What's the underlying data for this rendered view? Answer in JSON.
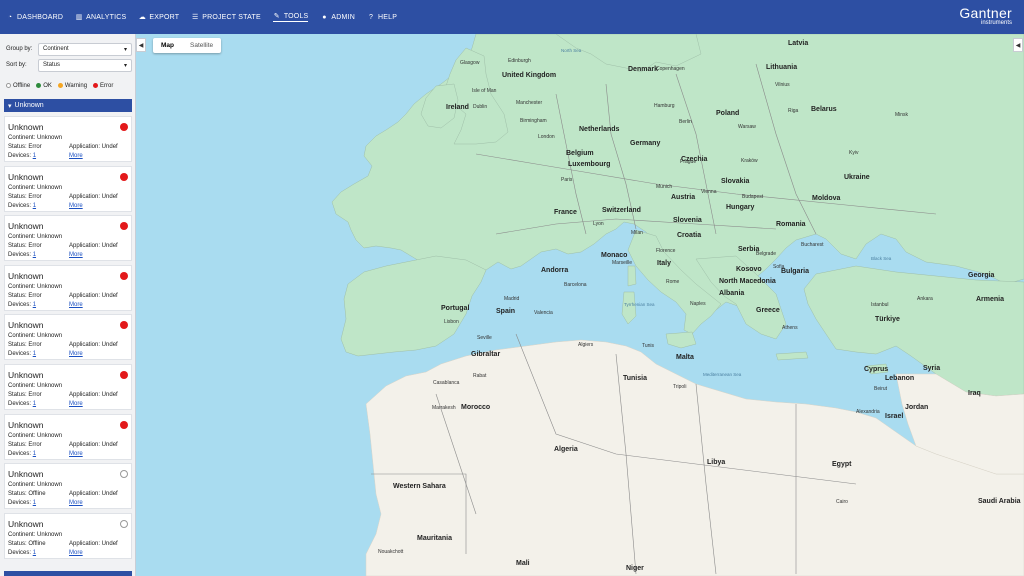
{
  "nav": {
    "items": [
      {
        "label": "DASHBOARD",
        "icon": "gauge-icon"
      },
      {
        "label": "ANALYTICS",
        "icon": "chart-icon"
      },
      {
        "label": "EXPORT",
        "icon": "cloud-icon"
      },
      {
        "label": "PROJECT STATE",
        "icon": "list-icon"
      },
      {
        "label": "TOOLS",
        "icon": "wrench-icon"
      },
      {
        "label": "ADMIN",
        "icon": "user-icon"
      },
      {
        "label": "HELP",
        "icon": "help-icon"
      }
    ],
    "brand": "Gantner",
    "brand_sub": "instruments"
  },
  "sidebar": {
    "group_by_label": "Group by:",
    "group_by_value": "Continent",
    "sort_by_label": "Sort by:",
    "sort_by_value": "Status",
    "legend": [
      {
        "label": "Offline",
        "color": "#ffffff"
      },
      {
        "label": "OK",
        "color": "#2e8b3c"
      },
      {
        "label": "Warning",
        "color": "#f5a623"
      },
      {
        "label": "Error",
        "color": "#e3191b"
      }
    ],
    "group_label": "Unknown",
    "card_labels": {
      "continent": "Continent: Unknown",
      "application": "Application: Undef",
      "devices": "Devices:",
      "devices_count": "1",
      "more": "More"
    },
    "cards": [
      {
        "title": "Unknown",
        "status": "Status: Error",
        "state": "error"
      },
      {
        "title": "Unknown",
        "status": "Status: Error",
        "state": "error"
      },
      {
        "title": "Unknown",
        "status": "Status: Error",
        "state": "error"
      },
      {
        "title": "Unknown",
        "status": "Status: Error",
        "state": "error"
      },
      {
        "title": "Unknown",
        "status": "Status: Error",
        "state": "error"
      },
      {
        "title": "Unknown",
        "status": "Status: Error",
        "state": "error"
      },
      {
        "title": "Unknown",
        "status": "Status: Error",
        "state": "error"
      },
      {
        "title": "Unknown",
        "status": "Status: Offline",
        "state": "offline"
      },
      {
        "title": "Unknown",
        "status": "Status: Offline",
        "state": "offline"
      }
    ]
  },
  "map": {
    "type_map": "Map",
    "type_satellite": "Satellite",
    "colors": {
      "sea": "#a9dcf0",
      "land_green": "#bfe6c8",
      "land_desert": "#f3f1ea"
    },
    "labels": [
      {
        "text": "Ireland",
        "cls": "big"
      },
      {
        "text": "United Kingdom",
        "cls": "big"
      },
      {
        "text": "Netherlands",
        "cls": "big"
      },
      {
        "text": "Belgium",
        "cls": "big"
      },
      {
        "text": "Luxembourg",
        "cls": "big"
      },
      {
        "text": "Germany",
        "cls": "big"
      },
      {
        "text": "Poland",
        "cls": "big"
      },
      {
        "text": "Lithuania",
        "cls": "big"
      },
      {
        "text": "Latvia",
        "cls": "big"
      },
      {
        "text": "Denmark",
        "cls": "big"
      },
      {
        "text": "Belarus",
        "cls": "big"
      },
      {
        "text": "Ukraine",
        "cls": "big"
      },
      {
        "text": "Czechia",
        "cls": "big"
      },
      {
        "text": "Slovakia",
        "cls": "big"
      },
      {
        "text": "Austria",
        "cls": "big"
      },
      {
        "text": "Hungary",
        "cls": "big"
      },
      {
        "text": "Moldova",
        "cls": "big"
      },
      {
        "text": "Romania",
        "cls": "big"
      },
      {
        "text": "France",
        "cls": "big"
      },
      {
        "text": "Switzerland",
        "cls": "big"
      },
      {
        "text": "Slovenia",
        "cls": "big"
      },
      {
        "text": "Croatia",
        "cls": "big"
      },
      {
        "text": "Serbia",
        "cls": "big"
      },
      {
        "text": "Bulgaria",
        "cls": "big"
      },
      {
        "text": "Monaco",
        "cls": "big"
      },
      {
        "text": "Italy",
        "cls": "big"
      },
      {
        "text": "Kosovo",
        "cls": "big"
      },
      {
        "text": "North Macedonia",
        "cls": "big"
      },
      {
        "text": "Albania",
        "cls": "big"
      },
      {
        "text": "Greece",
        "cls": "big"
      },
      {
        "text": "Andorra",
        "cls": "big"
      },
      {
        "text": "Portugal",
        "cls": "big"
      },
      {
        "text": "Spain",
        "cls": "big"
      },
      {
        "text": "Gibraltar",
        "cls": "big"
      },
      {
        "text": "Malta",
        "cls": "big"
      },
      {
        "text": "Tunisia",
        "cls": "big"
      },
      {
        "text": "Türkiye",
        "cls": "big"
      },
      {
        "text": "Georgia",
        "cls": "big"
      },
      {
        "text": "Armenia",
        "cls": "big"
      },
      {
        "text": "Cyprus",
        "cls": "big"
      },
      {
        "text": "Lebanon",
        "cls": "big"
      },
      {
        "text": "Syria",
        "cls": "big"
      },
      {
        "text": "Iraq",
        "cls": "big"
      },
      {
        "text": "Israel",
        "cls": "big"
      },
      {
        "text": "Jordan",
        "cls": "big"
      },
      {
        "text": "Morocco",
        "cls": "big"
      },
      {
        "text": "Algeria",
        "cls": "big"
      },
      {
        "text": "Libya",
        "cls": "big"
      },
      {
        "text": "Egypt",
        "cls": "big"
      },
      {
        "text": "Western Sahara",
        "cls": "big"
      },
      {
        "text": "Mauritania",
        "cls": "big"
      },
      {
        "text": "Mali",
        "cls": "big"
      },
      {
        "text": "Niger",
        "cls": "big"
      },
      {
        "text": "Saudi Arabia",
        "cls": "big"
      },
      {
        "text": "Dublin",
        "cls": "cty"
      },
      {
        "text": "Isle of Man",
        "cls": "cty"
      },
      {
        "text": "Manchester",
        "cls": "cty"
      },
      {
        "text": "Birmingham",
        "cls": "cty"
      },
      {
        "text": "London",
        "cls": "cty"
      },
      {
        "text": "Edinburgh",
        "cls": "cty"
      },
      {
        "text": "Glasgow",
        "cls": "cty"
      },
      {
        "text": "Paris",
        "cls": "cty"
      },
      {
        "text": "Lyon",
        "cls": "cty"
      },
      {
        "text": "Marseille",
        "cls": "cty"
      },
      {
        "text": "Milan",
        "cls": "cty"
      },
      {
        "text": "Florence",
        "cls": "cty"
      },
      {
        "text": "Rome",
        "cls": "cty"
      },
      {
        "text": "Naples",
        "cls": "cty"
      },
      {
        "text": "Hamburg",
        "cls": "cty"
      },
      {
        "text": "Berlin",
        "cls": "cty"
      },
      {
        "text": "Munich",
        "cls": "cty"
      },
      {
        "text": "Vienna",
        "cls": "cty"
      },
      {
        "text": "Prague",
        "cls": "cty"
      },
      {
        "text": "Warsaw",
        "cls": "cty"
      },
      {
        "text": "Kraków",
        "cls": "cty"
      },
      {
        "text": "Budapest",
        "cls": "cty"
      },
      {
        "text": "Belgrade",
        "cls": "cty"
      },
      {
        "text": "Bucharest",
        "cls": "cty"
      },
      {
        "text": "Sofia",
        "cls": "cty"
      },
      {
        "text": "Athens",
        "cls": "cty"
      },
      {
        "text": "Istanbul",
        "cls": "cty"
      },
      {
        "text": "Ankara",
        "cls": "cty"
      },
      {
        "text": "Vilnius",
        "cls": "cty"
      },
      {
        "text": "Riga",
        "cls": "cty"
      },
      {
        "text": "Minsk",
        "cls": "cty"
      },
      {
        "text": "Kyiv",
        "cls": "cty"
      },
      {
        "text": "Copenhagen",
        "cls": "cty"
      },
      {
        "text": "Madrid",
        "cls": "cty"
      },
      {
        "text": "Lisbon",
        "cls": "cty"
      },
      {
        "text": "Barcelona",
        "cls": "cty"
      },
      {
        "text": "Valencia",
        "cls": "cty"
      },
      {
        "text": "Seville",
        "cls": "cty"
      },
      {
        "text": "Casablanca",
        "cls": "cty"
      },
      {
        "text": "Rabat",
        "cls": "cty"
      },
      {
        "text": "Marrakesh",
        "cls": "cty"
      },
      {
        "text": "Algiers",
        "cls": "cty"
      },
      {
        "text": "Tunis",
        "cls": "cty"
      },
      {
        "text": "Tripoli",
        "cls": "cty"
      },
      {
        "text": "Cairo",
        "cls": "cty"
      },
      {
        "text": "Alexandria",
        "cls": "cty"
      },
      {
        "text": "Beirut",
        "cls": "cty"
      },
      {
        "text": "Nouakchott",
        "cls": "cty"
      },
      {
        "text": "North Sea",
        "cls": "sea"
      },
      {
        "text": "Black Sea",
        "cls": "sea"
      },
      {
        "text": "Tyrrhenian Sea",
        "cls": "sea"
      },
      {
        "text": "Mediterranean Sea",
        "cls": "sea"
      }
    ]
  }
}
